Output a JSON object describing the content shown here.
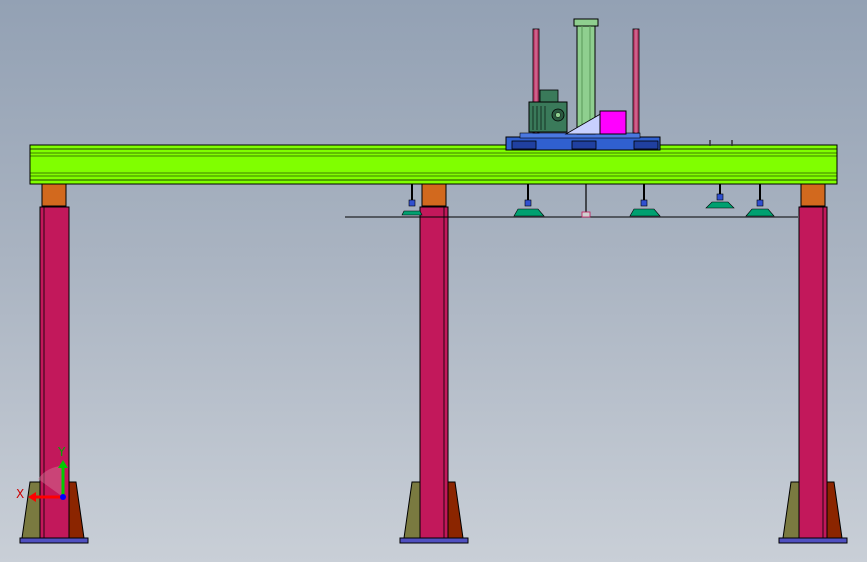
{
  "viewport": {
    "background_top": "#93a1b4",
    "background_bottom": "#c9cfd7"
  },
  "model": {
    "beam_color": "#80ff00",
    "column_color": "#c2185b",
    "column_cap_color": "#d2691e",
    "gusset_color": "#7a7a40",
    "gusset_shadow_color": "#8b2500",
    "base_plate_color": "#5050c0",
    "carriage_color": "#3060d0",
    "cylinder_color": "#8fcf8f",
    "guide_rod_color": "#c04070",
    "motor_color": "#3a7a5a",
    "block_color": "#ff00ff",
    "wedge_color": "#c8d0ff",
    "suction_cup_color": "#00a070",
    "suction_cup_base_color": "#3050d0"
  },
  "triad": {
    "x_label": "X",
    "y_label": "Y",
    "x_color": "#ff0000",
    "y_color": "#00cc00",
    "z_color": "#0000ff"
  }
}
